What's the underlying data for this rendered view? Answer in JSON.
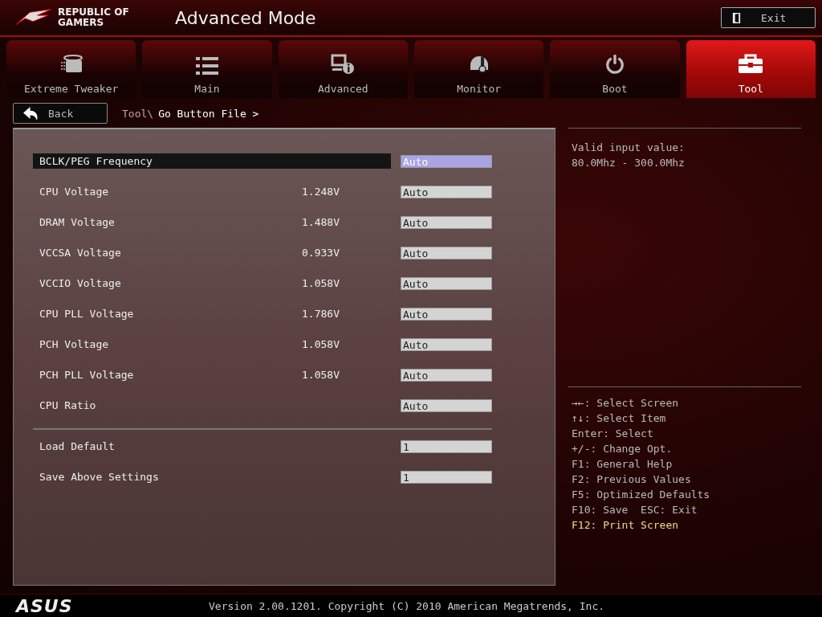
{
  "header": {
    "brand": [
      "REPUBLIC OF",
      "GAMERS"
    ],
    "title": "Advanced Mode",
    "exit_button": "Exit"
  },
  "tabs": [
    {
      "label": "Extreme Tweaker",
      "selected": false
    },
    {
      "label": "Main",
      "selected": false
    },
    {
      "label": "Advanced",
      "selected": false
    },
    {
      "label": "Monitor",
      "selected": false
    },
    {
      "label": "Boot",
      "selected": false
    },
    {
      "label": "Tool",
      "selected": true
    }
  ],
  "breadcrumb": {
    "back_button": "Back",
    "parent": "Tool\\",
    "current": "Go Button File >"
  },
  "settings": [
    {
      "name": "BCLK/PEG Frequency",
      "value": "Auto",
      "selected": true
    },
    {
      "name": "CPU Voltage",
      "reading": "1.248V",
      "value": "Auto",
      "selected": false
    },
    {
      "name": "DRAM Voltage",
      "reading": "1.488V",
      "value": "Auto",
      "selected": false
    },
    {
      "name": "VCCSA Voltage",
      "reading": "0.933V",
      "value": "Auto",
      "selected": false
    },
    {
      "name": "VCCIO Voltage",
      "reading": "1.058V",
      "value": "Auto",
      "selected": false
    },
    {
      "name": "CPU PLL Voltage",
      "reading": "1.786V",
      "value": "Auto",
      "selected": false
    },
    {
      "name": "PCH Voltage",
      "reading": "1.058V",
      "value": "Auto",
      "selected": false
    },
    {
      "name": "PCH PLL Voltage",
      "reading": "1.058V",
      "value": "Auto",
      "selected": false
    },
    {
      "name": "CPU Ratio",
      "value": "Auto",
      "selected": false
    }
  ],
  "actions": [
    {
      "name": "Load Default",
      "value": "1",
      "selected": false
    },
    {
      "name": "Save Above Settings",
      "value": "1",
      "selected": false
    }
  ],
  "help": [
    "Valid input value:",
    "80.0Mhz - 300.0Mhz"
  ],
  "keys": [
    {
      "text": "→←: Select Screen",
      "highlighted": false
    },
    {
      "text": "↑↓: Select Item",
      "highlighted": false
    },
    {
      "text": "Enter: Select",
      "highlighted": false
    },
    {
      "text": "+/-: Change Opt.",
      "highlighted": false
    },
    {
      "text": "F1: General Help",
      "highlighted": false
    },
    {
      "text": "F2: Previous Values",
      "highlighted": false
    },
    {
      "text": "F5: Optimized Defaults",
      "highlighted": false
    },
    {
      "text": "F10: Save  ESC: Exit",
      "highlighted": false
    },
    {
      "text": "F12: Print Screen",
      "highlighted": true
    }
  ],
  "footer": {
    "logo": "ASUS",
    "version": "Version 2.00.1201. Copyright (C) 2010 American Megatrends, Inc."
  }
}
